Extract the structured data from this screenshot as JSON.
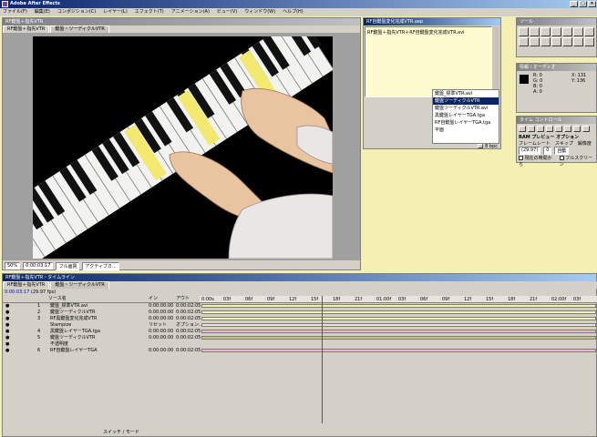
{
  "app": {
    "title": "Adobe After Effects"
  },
  "menu": [
    "ファイル(F)",
    "編集(E)",
    "コンポジション(C)",
    "レイヤー(L)",
    "エフェクト(T)",
    "アニメーション(A)",
    "ビュー(V)",
    "ウィンドウ(W)",
    "ヘルプ(H)"
  ],
  "comp_window": {
    "title": "RF鍵盤＋指先VTR",
    "tabs": [
      "RF鍵盤＋指先VTR",
      "鍵盤・ツーディクルVTR"
    ],
    "footer": {
      "zoom": "50%",
      "timecode": "0:00:03:17",
      "res": "フル画質",
      "quality": "アクティブカ..."
    }
  },
  "project_window": {
    "title": "RF自鍵盤変化完成VTR.aep",
    "header_text": "RF鍵盤＋指先VTR＋RF自鍵盤変化完成VTR.avi",
    "items": [
      "鍵盤_標準VTR.avi",
      "鍵盤ツーディクルVTR",
      "鍵盤ツーディクルVTR.avi",
      "黒鍵盤レイヤーTGA.tga",
      "RF自鍵盤レイヤーTGA.tga",
      "平面"
    ],
    "footer_bits": "8 bpc"
  },
  "tools_panel": {
    "title": "ツール"
  },
  "info_panel": {
    "title": "情報",
    "tab2": "オーディオ",
    "values": [
      "R: 0",
      "G: 0",
      "B: 0",
      "A: 0"
    ],
    "xy": [
      "X: 131",
      "Y: 136"
    ]
  },
  "time_controls": {
    "title": "タイム コントロール"
  },
  "ram_preview": {
    "title": "RAM プレビュー オプション",
    "labels": [
      "フレームレート",
      "スキップ",
      "解像度"
    ],
    "values": [
      "(29.97)",
      "0",
      "自動"
    ],
    "checks": [
      "現在の時間から",
      "フルスクリーン"
    ]
  },
  "timeline": {
    "title": "RF鍵盤＋指先VTR・タイムライン",
    "tabs": [
      "RF鍵盤＋指先VTR",
      "鍵盤・ツーディクルVTR"
    ],
    "timecode": "0:00:03:17",
    "fps": "(29.97 fps)",
    "col_headers": {
      "source": "ソース名",
      "in": "イン",
      "out": "アウト"
    },
    "ruler": [
      "0:00s",
      "03f",
      "06f",
      "09f",
      "12f",
      "15f",
      "18f",
      "21f",
      "01:00f",
      "03f",
      "06f",
      "09f",
      "12f",
      "15f",
      "18f",
      "21f",
      "02:00f",
      "03f"
    ],
    "layers": [
      {
        "num": "1",
        "name": "鍵盤_標準VTR.avi",
        "in": "0:00:00:00",
        "out": "0:00:02:05",
        "color": "#f0f0c0"
      },
      {
        "num": "2",
        "name": "鍵盤ツーディクルVTR",
        "in": "0:00:00:00",
        "out": "0:00:02:05",
        "color": "#f0f0c0"
      },
      {
        "num": "3",
        "name": "RF黒鍵盤変化完成VTR",
        "in": "0:00:00:00",
        "out": "0:00:02:05",
        "color": "#f0f0c0"
      },
      {
        "num": "",
        "name": "Stampize",
        "in": "リセット",
        "out": "オプション...",
        "color": "#e8e0f0"
      },
      {
        "num": "4",
        "name": "黒鍵盤レイヤーTGA.tga",
        "in": "0:00:00:00",
        "out": "0:00:02:05",
        "color": "#e8b8d8"
      },
      {
        "num": "5",
        "name": "鍵盤ツーディクルVTR",
        "in": "0:00:00:00",
        "out": "0:00:02:05",
        "color": "#c0c090"
      },
      {
        "num": "",
        "name": "不透明度",
        "in": "",
        "out": "",
        "color": ""
      },
      {
        "num": "6",
        "name": "RF自鍵盤レイヤーTGA",
        "in": "0:00:00:00",
        "out": "0:00:02:05",
        "color": "#e8b8d8"
      }
    ],
    "footer": "スイッチ / モード"
  }
}
